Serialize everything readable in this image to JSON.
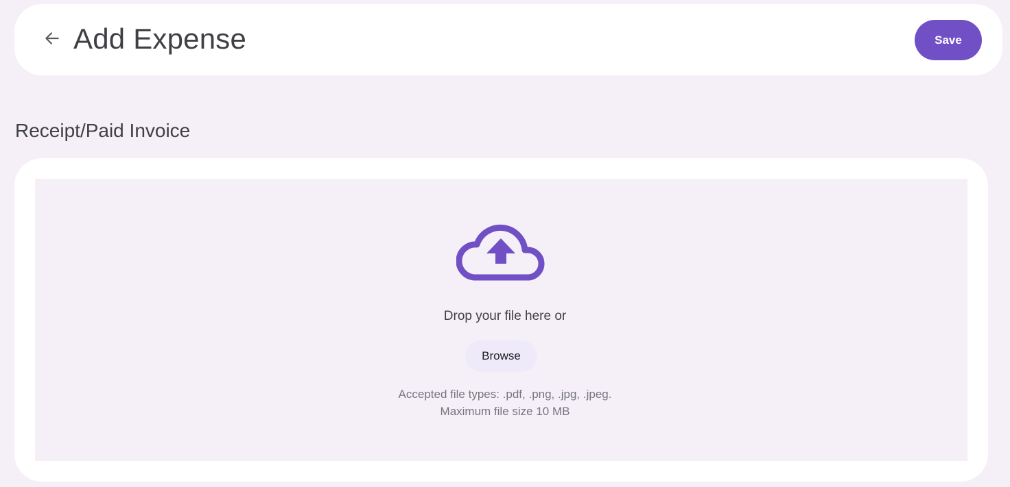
{
  "header": {
    "back_icon": "arrow-left-icon",
    "title": "Add Expense",
    "save_label": "Save"
  },
  "section": {
    "title": "Receipt/Paid Invoice"
  },
  "upload": {
    "icon": "cloud-upload-icon",
    "drop_text": "Drop your file here or",
    "browse_label": "Browse",
    "accepted_types": "Accepted file types: .pdf, .png, .jpg, .jpeg.",
    "max_size": "Maximum file size 10 MB"
  },
  "colors": {
    "accent": "#7150c6",
    "background": "#f5f0f7",
    "card": "#ffffff",
    "text": "#3f3f46",
    "muted_text": "#75757e",
    "browse_bg": "#efeaf9"
  }
}
